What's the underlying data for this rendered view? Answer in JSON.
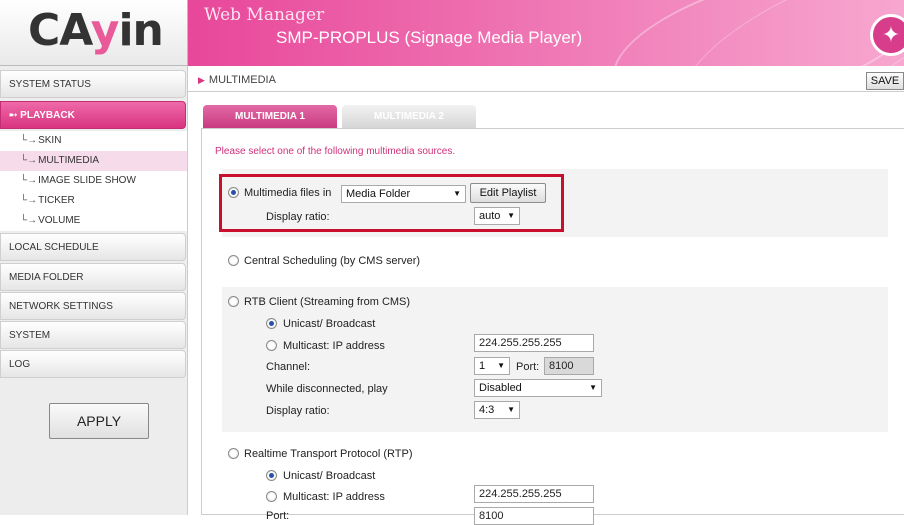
{
  "logo": {
    "text_main": "CA",
    "text_y": "y",
    "text_end": "in"
  },
  "header": {
    "title": "Web Manager",
    "subtitle": "SMP-PROPLUS (Signage Media Player)"
  },
  "sidebar": {
    "items": [
      {
        "label": "SYSTEM STATUS"
      },
      {
        "label": "PLAYBACK"
      },
      {
        "label": "LOCAL SCHEDULE"
      },
      {
        "label": "MEDIA FOLDER"
      },
      {
        "label": "NETWORK SETTINGS"
      },
      {
        "label": "SYSTEM"
      },
      {
        "label": "LOG"
      }
    ],
    "playback_sub": [
      {
        "label": "SKIN"
      },
      {
        "label": "MULTIMEDIA"
      },
      {
        "label": "IMAGE SLIDE SHOW"
      },
      {
        "label": "TICKER"
      },
      {
        "label": "VOLUME"
      }
    ],
    "apply_label": "APPLY"
  },
  "breadcrumb": "MULTIMEDIA",
  "save_label": "SAVE",
  "tabs": [
    {
      "label": "MULTIMEDIA 1"
    },
    {
      "label": "MULTIMEDIA 2"
    }
  ],
  "instruction": "Please select one of the following multimedia sources.",
  "multimedia_files": {
    "label": "Multimedia files in",
    "source_value": "Media Folder",
    "edit_playlist_label": "Edit Playlist",
    "display_ratio_label": "Display ratio:",
    "display_ratio_value": "auto"
  },
  "central_scheduling": {
    "label": "Central Scheduling (by CMS server)"
  },
  "rtb_client": {
    "label": "RTB Client (Streaming from CMS)",
    "unicast_label": "Unicast/ Broadcast",
    "multicast_label": "Multicast: IP address",
    "ip_value": "224.255.255.255",
    "channel_label": "Channel:",
    "channel_value": "1",
    "port_label": "Port:",
    "port_value": "8100",
    "disconnected_label": "While disconnected, play",
    "disconnected_value": "Disabled",
    "display_ratio_label": "Display ratio:",
    "display_ratio_value": "4:3"
  },
  "rtp": {
    "label": "Realtime Transport Protocol (RTP)",
    "unicast_label": "Unicast/ Broadcast",
    "multicast_label": "Multicast: IP address",
    "ip_value": "224.255.255.255",
    "port_label": "Port:",
    "port_value": "8100"
  },
  "selection": {
    "source": "multimedia_files",
    "rtb_mode": "unicast",
    "rtp_mode": "unicast"
  },
  "colors": {
    "brand_pink": "#d9347f",
    "highlight_red": "#c8102e"
  }
}
